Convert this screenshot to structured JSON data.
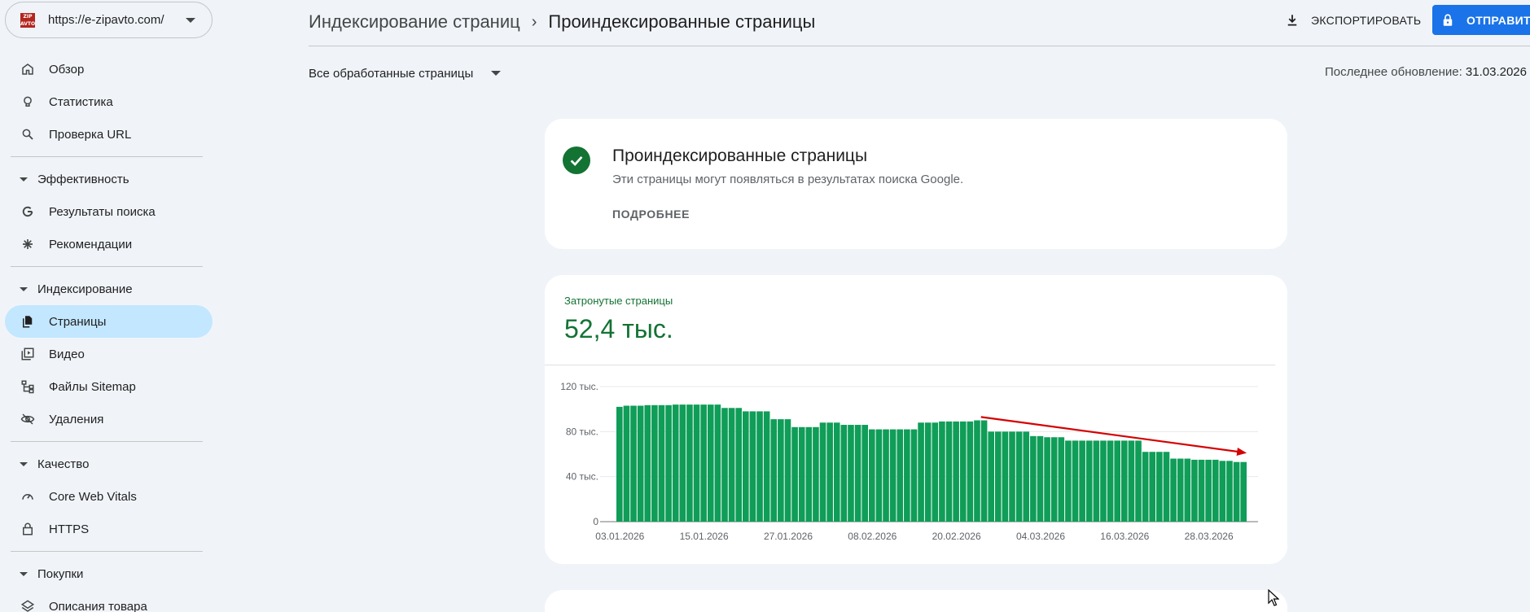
{
  "property": {
    "url": "https://e-zipavto.com/",
    "logo_text": "ZIP AVTO"
  },
  "nav": {
    "overview": "Обзор",
    "insights": "Статистика",
    "url_inspection": "Проверка URL",
    "section_performance": "Эффективность",
    "search_results": "Результаты поиска",
    "recommendations": "Рекомендации",
    "section_indexing": "Индексирование",
    "pages": "Страницы",
    "videos": "Видео",
    "sitemaps": "Файлы Sitemap",
    "removals": "Удаления",
    "section_quality": "Качество",
    "core_web_vitals": "Core Web Vitals",
    "https": "HTTPS",
    "section_shopping": "Покупки",
    "product_snippets": "Описания товара"
  },
  "header": {
    "crumb_parent": "Индексирование страниц",
    "crumb_sep": "›",
    "crumb_current": "Проиндексированные страницы",
    "export_label": "ЭКСПОРТИРОВАТЬ",
    "submit_label": "ОТПРАВИТЬ"
  },
  "filter": {
    "selected": "Все обработанные страницы"
  },
  "updated": {
    "label": "Последнее обновление:",
    "date": "31.03.2026"
  },
  "status_card": {
    "title": "Проиндексированные страницы",
    "description": "Эти страницы могут появляться в результатах поиска Google.",
    "learn_more": "ПОДРОБНЕЕ"
  },
  "metric": {
    "label": "Затронутые страницы",
    "value": "52,4 тыс."
  },
  "colors": {
    "accent": "#1a73e8",
    "bar": "#0f9d58",
    "metric": "#137333",
    "arrow": "#d50000"
  },
  "chart_data": {
    "type": "bar",
    "y_tick_labels": [
      "0",
      "40 тыс.",
      "80 тыс.",
      "120 тыс."
    ],
    "y_tick_values": [
      0,
      40000,
      80000,
      120000
    ],
    "ylim": [
      0,
      120000
    ],
    "x_tick_labels": [
      "03.01.2026",
      "15.01.2026",
      "27.01.2026",
      "08.02.2026",
      "20.02.2026",
      "04.03.2026",
      "16.03.2026",
      "28.03.2026"
    ],
    "x_tick_index": [
      0,
      12,
      24,
      36,
      48,
      60,
      72,
      84
    ],
    "grid": true,
    "values": [
      102000,
      103000,
      103000,
      103000,
      103500,
      103500,
      103500,
      103500,
      104000,
      104000,
      104000,
      104000,
      104000,
      104000,
      104000,
      101000,
      101000,
      101000,
      98000,
      98000,
      98000,
      98000,
      91000,
      91000,
      91000,
      84000,
      84000,
      84000,
      84000,
      88000,
      88000,
      88000,
      86000,
      86000,
      86000,
      86000,
      82000,
      82000,
      82000,
      82000,
      82000,
      82000,
      82000,
      88000,
      88000,
      88000,
      89000,
      89000,
      89000,
      89000,
      89000,
      90000,
      90000,
      80000,
      80000,
      80000,
      80000,
      80000,
      80000,
      76000,
      76000,
      75000,
      75000,
      75000,
      72000,
      72000,
      72000,
      72000,
      72000,
      72000,
      72000,
      72000,
      72000,
      72000,
      72000,
      62000,
      62000,
      62000,
      62000,
      56000,
      56000,
      56000,
      55000,
      55000,
      55000,
      55000,
      54000,
      54000,
      53000,
      53000
    ],
    "annotation": "trend-arrow-down"
  }
}
